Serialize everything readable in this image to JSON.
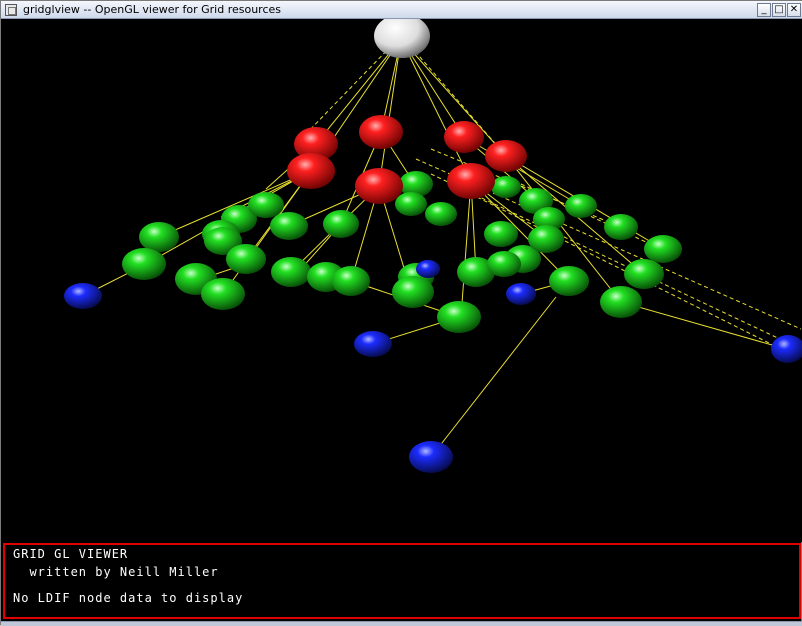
{
  "window": {
    "title": "gridglview -- OpenGL viewer for Grid resources",
    "controls": {
      "minimize": "_",
      "maximize": "□",
      "close": "✕"
    }
  },
  "console": {
    "heading": "GRID GL VIEWER",
    "credit": "  written by Neill Miller",
    "message": "No LDIF node data to display"
  },
  "colors": {
    "root_node": "#ffffff",
    "site_node": "#ff1010",
    "host_node": "#22e022",
    "leaf_node": "#2030ff",
    "edge": "#e8e030",
    "console_border": "#e00000"
  }
}
